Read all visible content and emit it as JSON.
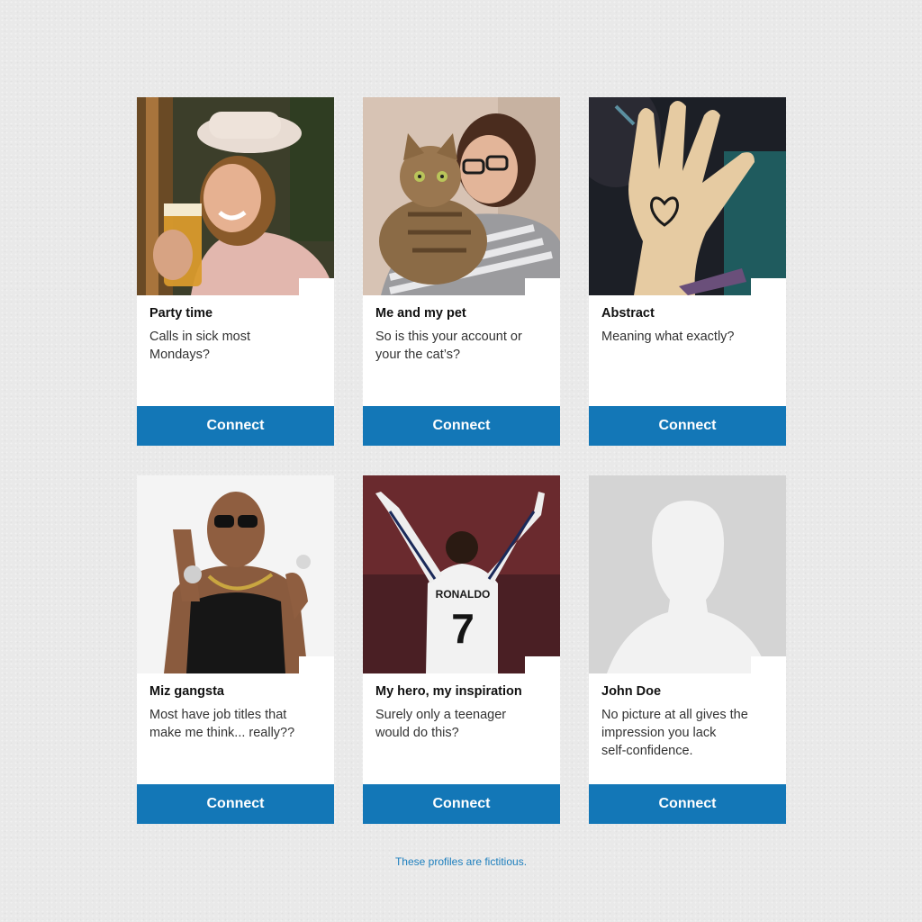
{
  "profiles": [
    {
      "title": "Party time",
      "description": "Calls in sick most\nMondays?",
      "connect_label": "Connect",
      "photo": "woman-with-beer-photo"
    },
    {
      "title": "Me and my pet",
      "description": "So is this your account or\nyour the cat’s?",
      "connect_label": "Connect",
      "photo": "woman-with-cat-photo"
    },
    {
      "title": "Abstract",
      "description": "Meaning what exactly?",
      "connect_label": "Connect",
      "photo": "hand-with-heart-photo"
    },
    {
      "title": "Miz gangsta",
      "description": "Most have job titles that\nmake me think... really??",
      "connect_label": "Connect",
      "photo": "man-with-sunglasses-photo"
    },
    {
      "title": "My hero, my inspiration",
      "description": "Surely only a teenager\nwould do this?",
      "connect_label": "Connect",
      "photo": "football-player-photo",
      "jersey_name": "RONALDO",
      "jersey_number": "7"
    },
    {
      "title": "John Doe",
      "description": "No picture at all gives the\nimpression you lack\nself-confidence.",
      "connect_label": "Connect",
      "photo": "default-avatar-silhouette"
    }
  ],
  "footnote": "These profiles are fictitious.",
  "colors": {
    "connect_button": "#1377b7",
    "footnote": "#1d7fbe",
    "background": "#e9e9e9"
  }
}
